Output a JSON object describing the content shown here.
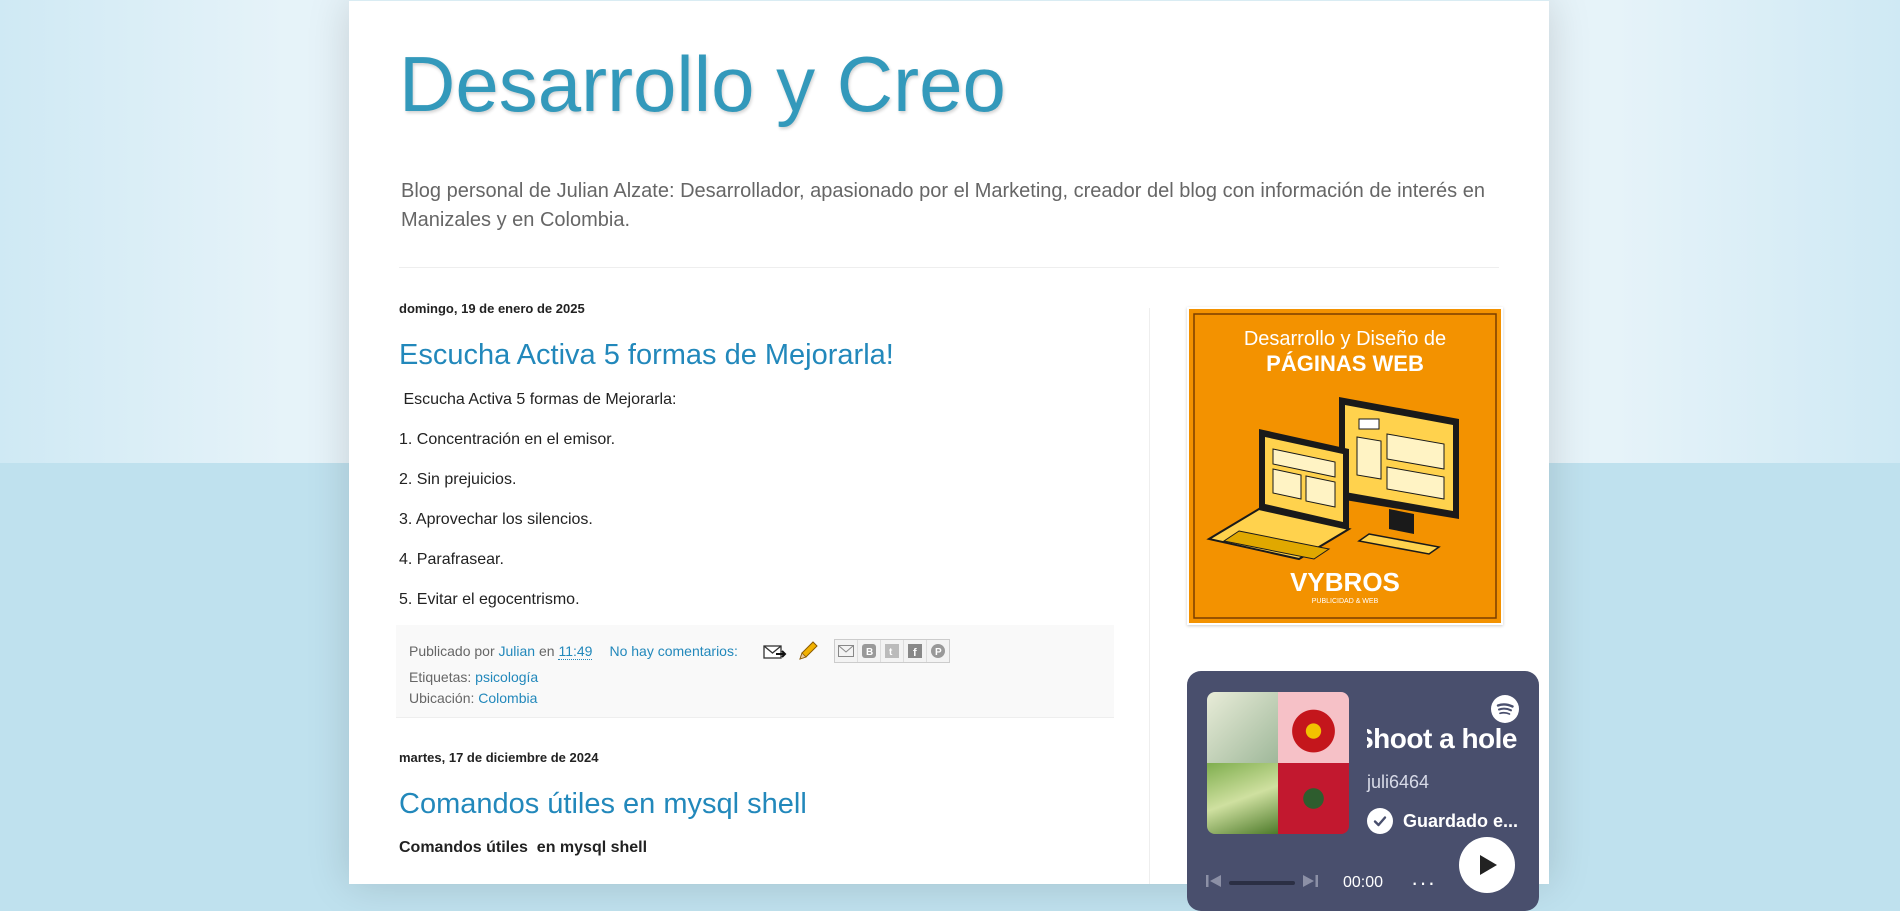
{
  "blog": {
    "title": "Desarrollo y Creo",
    "description": "Blog personal de Julian Alzate: Desarrollador, apasionado por el Marketing, creador del blog con información de interés en Manizales y en Colombia."
  },
  "posts": [
    {
      "date": "domingo, 19 de enero de 2025",
      "title": "Escucha Activa 5 formas de Mejorarla!",
      "body": [
        " Escucha Activa 5 formas de Mejorarla:",
        "1. Concentración en el emisor.",
        "2. Sin prejuicios.",
        "3. Aprovechar los silencios.",
        "4. Parafrasear.",
        "5. Evitar el egocentrismo."
      ],
      "footer": {
        "published_by_label": "Publicado por",
        "author": "Julian",
        "at_label": "en",
        "time": "11:49",
        "comments": "No hay comentarios:",
        "labels_label": "Etiquetas:",
        "label": "psicología",
        "location_label": "Ubicación:",
        "location": "Colombia"
      }
    },
    {
      "date": "martes, 17 de diciembre de 2024",
      "title": "Comandos útiles en mysql shell",
      "body_bold": "Comandos útiles  en mysql shell"
    }
  ],
  "share_buttons": [
    "email-share",
    "blogger-share",
    "twitter-share",
    "facebook-share",
    "pinterest-share"
  ],
  "sidebar": {
    "ad": {
      "line1": "Desarrollo y Diseño de",
      "line2": "PÁGINAS WEB",
      "brand": "VYBROS",
      "brand_sub": "PUBLICIDAD & WEB",
      "bg_color": "#f39200"
    },
    "spotify": {
      "title": "Shoot a hole v",
      "user": "juli6464",
      "saved": "Guardado e...",
      "time": "00:00",
      "more": "···",
      "bg_color": "#494f6d"
    }
  },
  "colors": {
    "title": "#3399bb",
    "link": "#2288bb",
    "background": "#bfe1ee"
  }
}
